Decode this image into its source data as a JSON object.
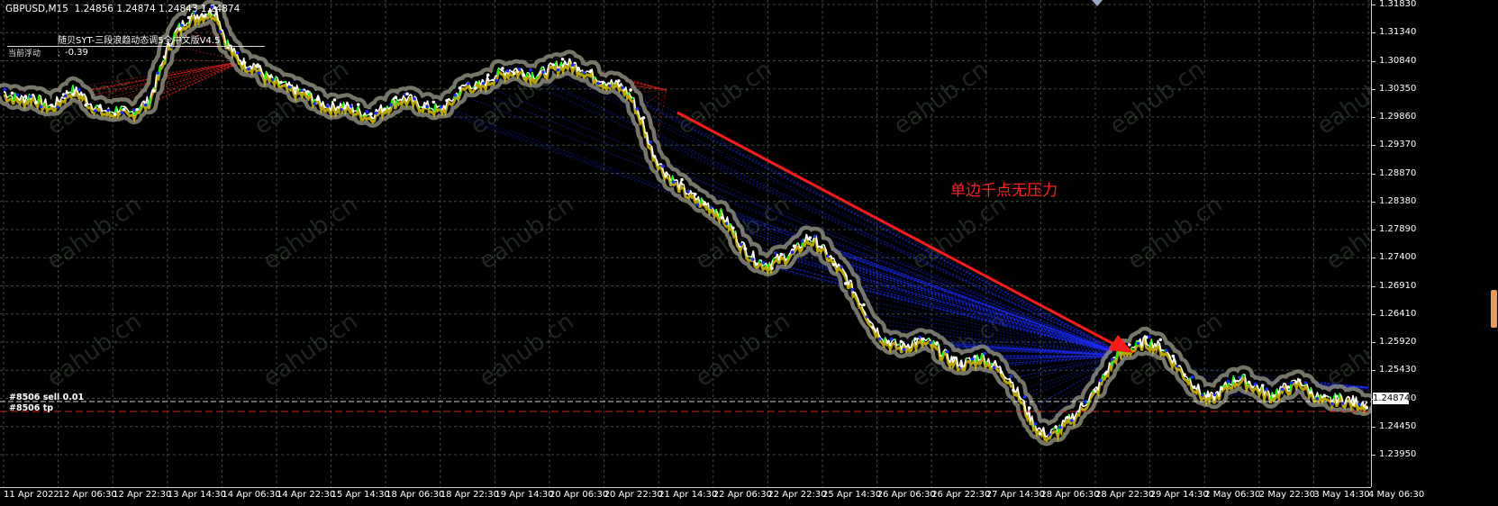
{
  "header": {
    "symbol": "GBPUSD,M15",
    "ohlc": "1.24856 1.24874 1.24843 1.24874"
  },
  "ea_panel": {
    "title": "随贝SYT-三段浪趋动态调5全中文版V4.5",
    "float_label": "当前浮动",
    "float_colon": ":",
    "float_value": "-0.39"
  },
  "orders": {
    "order_label": "#8506 sell 0.01",
    "tp_label": "#8506 tp"
  },
  "annotation": "单边千点无压力",
  "watermark": "eahub.cn",
  "price_axis": {
    "ticks": [
      "1.31830",
      "1.31340",
      "1.30840",
      "1.30350",
      "1.29860",
      "1.29370",
      "1.28870",
      "1.28380",
      "1.27890",
      "1.27400",
      "1.26910",
      "1.26410",
      "1.25920",
      "1.25430",
      "1.24940",
      "1.24450",
      "1.23950"
    ],
    "current_price": "1.24874"
  },
  "time_axis": {
    "ticks": [
      "11 Apr 2022",
      "12 Apr 06:30",
      "12 Apr 22:30",
      "13 Apr 14:30",
      "14 Apr 06:30",
      "14 Apr 22:30",
      "15 Apr 14:30",
      "18 Apr 06:30",
      "18 Apr 22:30",
      "19 Apr 14:30",
      "20 Apr 06:30",
      "20 Apr 22:30",
      "21 Apr 14:30",
      "22 Apr 06:30",
      "22 Apr 22:30",
      "25 Apr 14:30",
      "26 Apr 06:30",
      "26 Apr 22:30",
      "27 Apr 14:30",
      "28 Apr 06:30",
      "28 Apr 22:30",
      "29 Apr 14:30",
      "2 May 06:30",
      "2 May 22:30",
      "3 May 14:30",
      "4 May 06:30"
    ]
  },
  "colors": {
    "background": "#000000",
    "grid": "#3d4a3d",
    "candle_up": "#00ff00",
    "candle_down": "#ffffff",
    "halo": "#8a8a7a",
    "fan_blue": "#1a2cff",
    "fan_red": "#ff2020",
    "arrow": "#ff1a1a",
    "tp_line": "#cc2020",
    "order_line": "#ffffff"
  },
  "chart_data": {
    "type": "line",
    "title": "GBPUSD,M15",
    "xlabel": "",
    "ylabel": "",
    "ylim": [
      1.2395,
      1.3183
    ],
    "x_ticks": [
      "11 Apr 2022",
      "12 Apr 06:30",
      "12 Apr 22:30",
      "13 Apr 14:30",
      "14 Apr 06:30",
      "14 Apr 22:30",
      "15 Apr 14:30",
      "18 Apr 06:30",
      "18 Apr 22:30",
      "19 Apr 14:30",
      "20 Apr 06:30",
      "20 Apr 22:30",
      "21 Apr 14:30",
      "22 Apr 06:30",
      "22 Apr 22:30",
      "25 Apr 14:30",
      "26 Apr 06:30",
      "26 Apr 22:30",
      "27 Apr 14:30",
      "28 Apr 06:30",
      "28 Apr 22:30",
      "29 Apr 14:30",
      "2 May 06:30",
      "2 May 22:30",
      "3 May 14:30",
      "4 May 06:30"
    ],
    "series": [
      {
        "values": [
          1.303,
          1.3022,
          1.3018,
          1.3025,
          1.3012,
          1.3005,
          1.302,
          1.3035,
          1.3028,
          1.301,
          1.3,
          1.2995,
          1.3002,
          1.299,
          1.3005,
          1.3015,
          1.306,
          1.311,
          1.314,
          1.3158,
          1.3165,
          1.317,
          1.3172,
          1.312,
          1.3095,
          1.308,
          1.3078,
          1.306,
          1.305,
          1.3042,
          1.3035,
          1.303,
          1.302,
          1.301,
          1.3005,
          1.3008,
          1.3002,
          1.2995,
          1.299,
          1.3,
          1.301,
          1.302,
          1.3018,
          1.301,
          1.3005,
          1.3,
          1.301,
          1.303,
          1.3045,
          1.304,
          1.305,
          1.3062,
          1.3068,
          1.307,
          1.3065,
          1.306,
          1.3068,
          1.3075,
          1.3082,
          1.3078,
          1.307,
          1.306,
          1.305,
          1.3045,
          1.304,
          1.302,
          1.298,
          1.293,
          1.29,
          1.288,
          1.2865,
          1.285,
          1.284,
          1.2832,
          1.282,
          1.28,
          1.277,
          1.275,
          1.2735,
          1.273,
          1.2738,
          1.2745,
          1.2755,
          1.2775,
          1.277,
          1.275,
          1.273,
          1.271,
          1.268,
          1.265,
          1.262,
          1.26,
          1.259,
          1.2585,
          1.2592,
          1.2595,
          1.259,
          1.2575,
          1.2562,
          1.2555,
          1.256,
          1.2568,
          1.256,
          1.2545,
          1.253,
          1.25,
          1.2465,
          1.244,
          1.243,
          1.244,
          1.2455,
          1.247,
          1.249,
          1.251,
          1.254,
          1.257,
          1.258,
          1.2585,
          1.2595,
          1.259,
          1.258,
          1.256,
          1.254,
          1.252,
          1.25,
          1.2495,
          1.251,
          1.2525,
          1.253,
          1.252,
          1.251,
          1.25,
          1.251,
          1.2515,
          1.2525,
          1.251,
          1.2495,
          1.249,
          1.2495,
          1.2492,
          1.2488,
          1.2487
        ]
      }
    ],
    "current_price": 1.24874,
    "grid": true
  }
}
